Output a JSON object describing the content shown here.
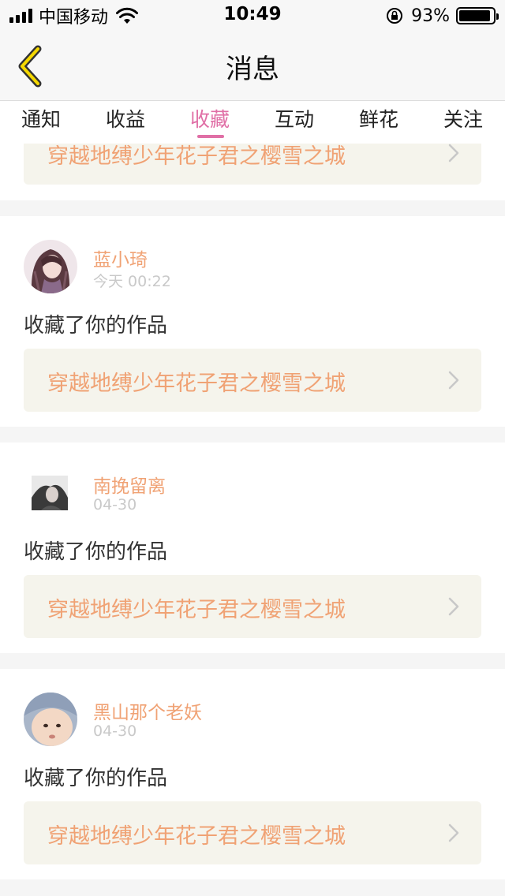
{
  "status_bar": {
    "carrier": "中国移动",
    "time": "10:49",
    "battery_percent": "93%",
    "battery_level": 0.93
  },
  "nav": {
    "title": "消息",
    "back_icon": "chevron-left-icon",
    "accent_color": "#f5d800"
  },
  "tabs": [
    "通知",
    "收益",
    "收藏",
    "互动",
    "鲜花",
    "关注"
  ],
  "active_tab": "收藏",
  "colors": {
    "active_tab": "#e06fa6",
    "username": "#f0a274",
    "work_title": "#f0a274",
    "work_bg": "#f5f4ec"
  },
  "partial_card": {
    "work_title": "穿越地缚少年花子君之樱雪之城"
  },
  "notifications": [
    {
      "username": "蓝小琦",
      "time": "今天 00:22",
      "action": "收藏了你的作品",
      "work_title": "穿越地缚少年花子君之樱雪之城",
      "avatar": "anime-girl-avatar"
    },
    {
      "username": "南挽留离",
      "time": "04-30",
      "action": "收藏了你的作品",
      "work_title": "穿越地缚少年花子君之樱雪之城",
      "avatar": "photo-avatar"
    },
    {
      "username": "黑山那个老妖",
      "time": "04-30",
      "action": "收藏了你的作品",
      "work_title": "穿越地缚少年花子君之樱雪之城",
      "avatar": "baby-avatar"
    }
  ]
}
